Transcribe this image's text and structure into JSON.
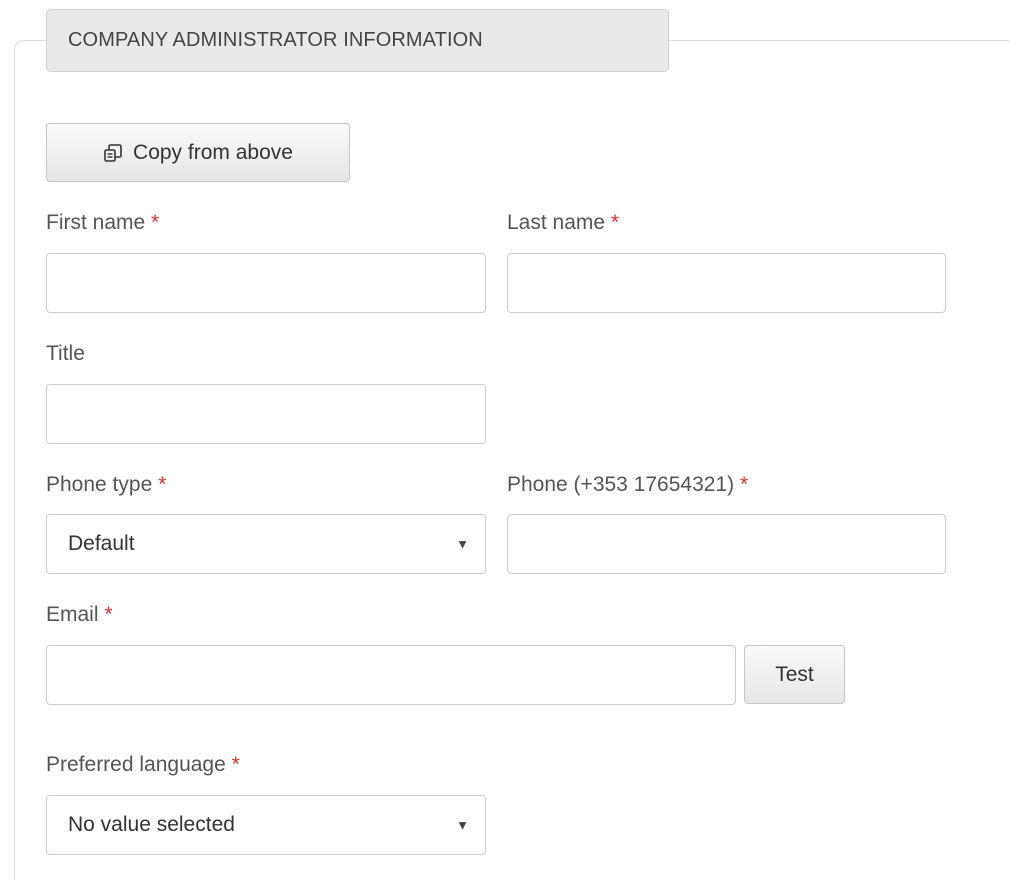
{
  "section": {
    "legend": "COMPANY ADMINISTRATOR INFORMATION"
  },
  "copy_button": {
    "label": "Copy from above",
    "icon": "copy-icon"
  },
  "required_marker": "*",
  "fields": {
    "first_name": {
      "label": "First name",
      "required": true,
      "value": ""
    },
    "last_name": {
      "label": "Last name",
      "required": true,
      "value": ""
    },
    "title": {
      "label": "Title",
      "required": false,
      "value": ""
    },
    "phone_type": {
      "label": "Phone type",
      "required": true,
      "selected": "Default",
      "caret": "▼"
    },
    "phone": {
      "label": "Phone (+353 17654321)",
      "required": true,
      "value": ""
    },
    "email": {
      "label": "Email",
      "required": true,
      "value": ""
    },
    "preferred_language": {
      "label": "Preferred language",
      "required": true,
      "selected": "No value selected",
      "caret": "▼"
    }
  },
  "test_button": {
    "label": "Test"
  },
  "colors": {
    "required": "#d9332e",
    "legend_bg": "#e9e9e9",
    "border": "#cccccc"
  }
}
